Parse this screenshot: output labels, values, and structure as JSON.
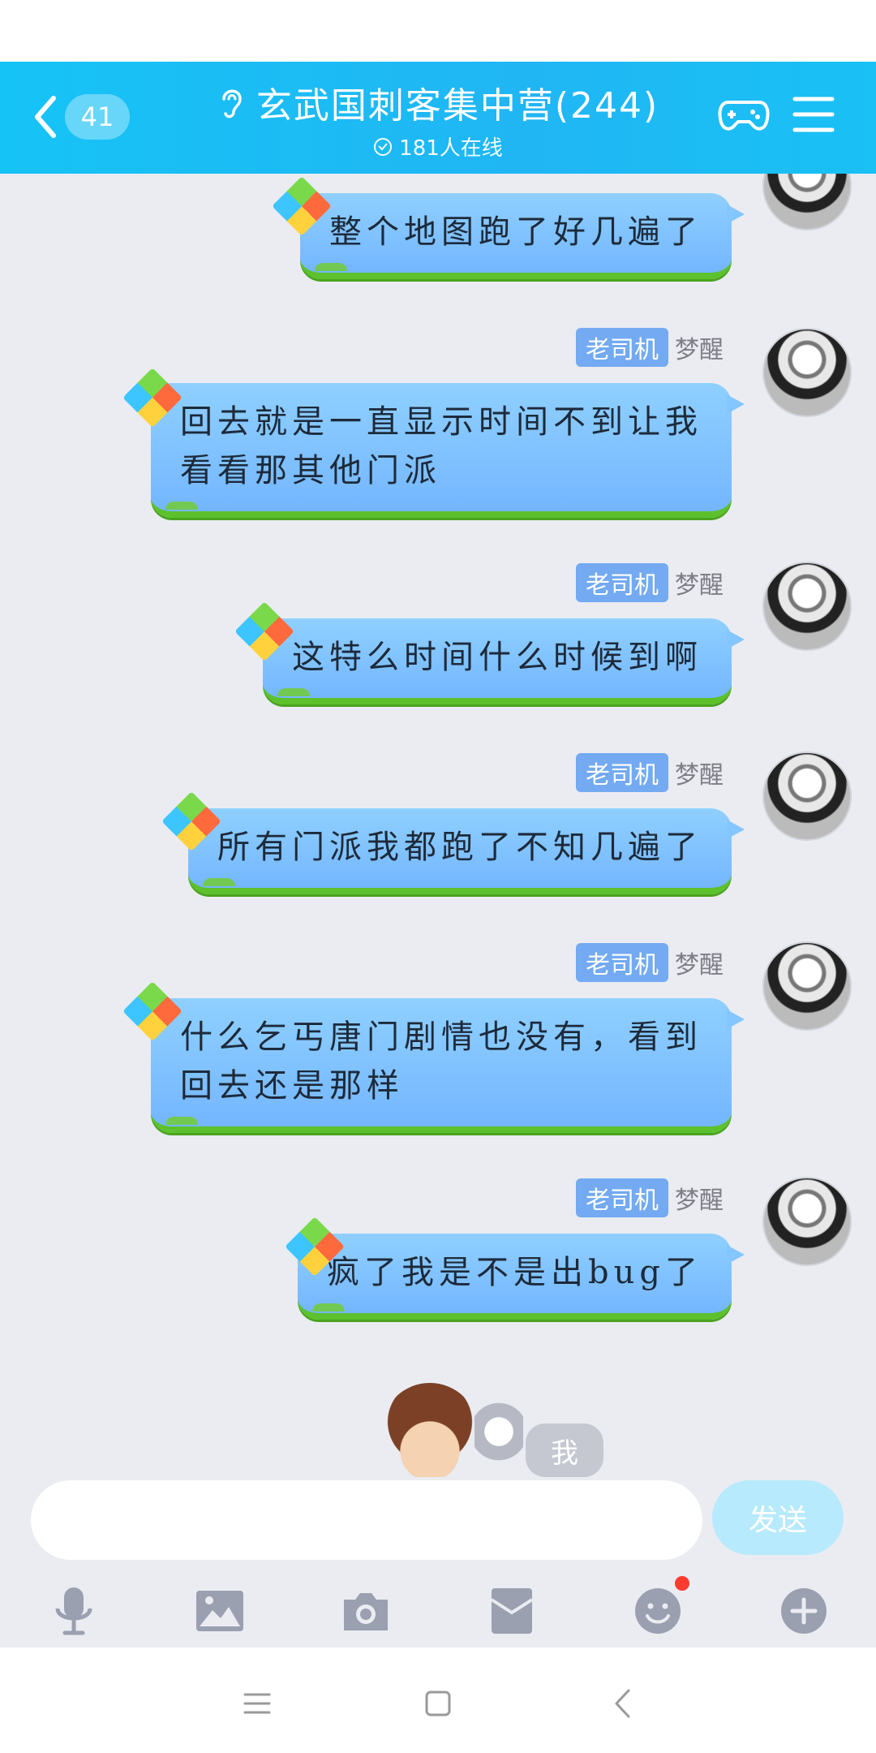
{
  "header": {
    "unread_count": "41",
    "title": "玄武国刺客集中营(244)",
    "online_text": "181人在线"
  },
  "messages": [
    {
      "tag": "",
      "nick": "",
      "text": "整个地图跑了好几遍了"
    },
    {
      "tag": "老司机",
      "nick": "梦醒",
      "text": "回去就是一直显示时间不到让我\n看看那其他门派"
    },
    {
      "tag": "老司机",
      "nick": "梦醒",
      "text": "这特么时间什么时候到啊"
    },
    {
      "tag": "老司机",
      "nick": "梦醒",
      "text": "所有门派我都跑了不知几遍了"
    },
    {
      "tag": "老司机",
      "nick": "梦醒",
      "text": "什么乞丐唐门剧情也没有，看到\n回去还是那样"
    },
    {
      "tag": "老司机",
      "nick": "梦醒",
      "text": "疯了我是不是出bug了"
    }
  ],
  "me_badge": "我",
  "input": {
    "value": "",
    "placeholder": ""
  },
  "send_label": "发送",
  "toolbar": [
    "mic-icon",
    "image-icon",
    "camera-icon",
    "red-packet-icon",
    "emoji-icon",
    "plus-icon"
  ],
  "colors": {
    "header": "#1dbdf5",
    "bubble": "#84c6ff",
    "tag": "#73aaf1",
    "send": "#b7eafc",
    "notify": "#ff3b30"
  }
}
